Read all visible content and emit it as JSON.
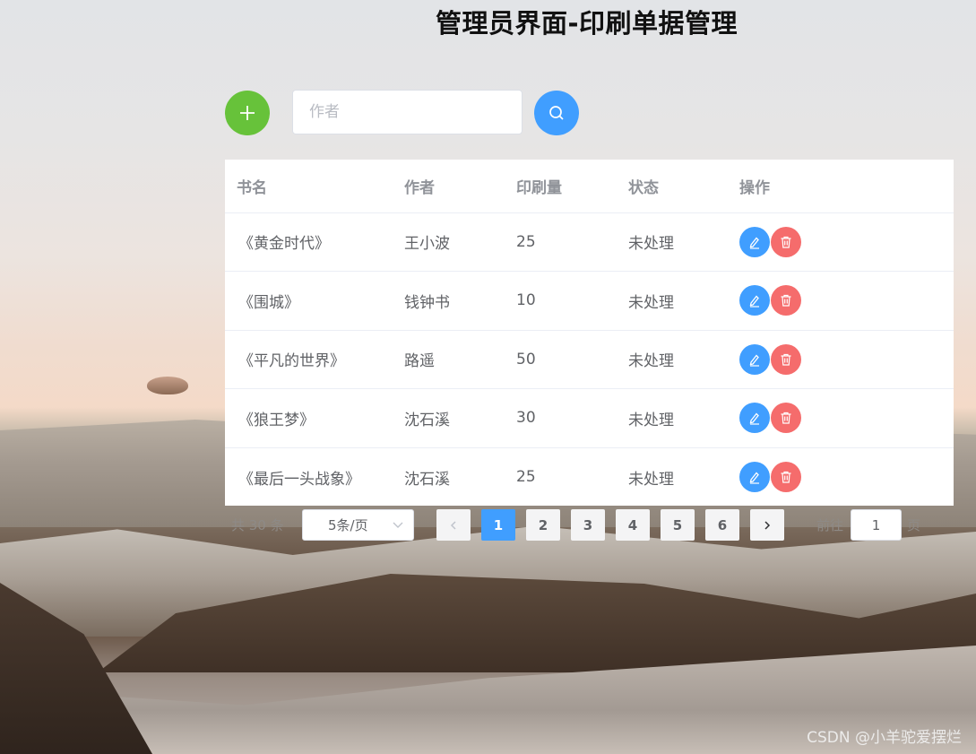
{
  "page": {
    "title": "管理员界面-印刷单据管理"
  },
  "toolbar": {
    "add_icon": "plus-icon",
    "search_placeholder": "作者",
    "search_value": "",
    "search_icon": "search-icon",
    "add_color": "#67c23a",
    "search_color": "#409eff"
  },
  "table": {
    "columns": [
      "书名",
      "作者",
      "印刷量",
      "状态",
      "操作"
    ],
    "rows": [
      {
        "book": "《黄金时代》",
        "author": "王小波",
        "quantity": "25",
        "status": "未处理"
      },
      {
        "book": "《围城》",
        "author": "钱钟书",
        "quantity": "10",
        "status": "未处理"
      },
      {
        "book": "《平凡的世界》",
        "author": "路遥",
        "quantity": "50",
        "status": "未处理"
      },
      {
        "book": "《狼王梦》",
        "author": "沈石溪",
        "quantity": "30",
        "status": "未处理"
      },
      {
        "book": "《最后一头战象》",
        "author": "沈石溪",
        "quantity": "25",
        "status": "未处理"
      }
    ],
    "edit_icon": "edit-icon",
    "delete_icon": "delete-icon",
    "edit_color": "#409eff",
    "delete_color": "#f56c6c"
  },
  "pagination": {
    "total_text": "共 30 条",
    "page_size": "5条/页",
    "pages": [
      "1",
      "2",
      "3",
      "4",
      "5",
      "6"
    ],
    "current_page": "1",
    "goto_prefix": "前往",
    "goto_value": "1",
    "goto_suffix": "页",
    "prev_icon": "chevron-left-icon",
    "next_icon": "chevron-right-icon",
    "active_color": "#409eff"
  },
  "watermark": "CSDN @小羊驼爱摆烂"
}
